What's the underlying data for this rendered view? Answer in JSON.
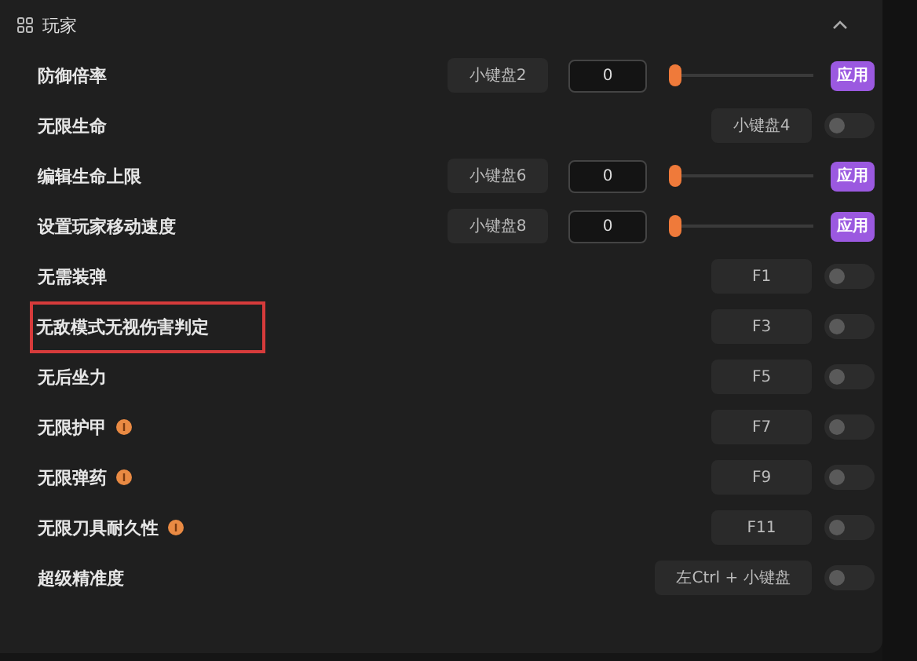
{
  "section": {
    "title": "玩家",
    "expanded": true
  },
  "rows": [
    {
      "kind": "slider",
      "label": "防御倍率",
      "hotkey": "小键盘2",
      "value": "0",
      "level": 0,
      "button": "应用",
      "info": false,
      "highlighted": false
    },
    {
      "kind": "toggle",
      "label": "无限生命",
      "hotkey": "小键盘4",
      "on": false,
      "info": false,
      "highlighted": false
    },
    {
      "kind": "slider",
      "label": "编辑生命上限",
      "hotkey": "小键盘6",
      "value": "0",
      "level": 0,
      "button": "应用",
      "info": false,
      "highlighted": false
    },
    {
      "kind": "slider",
      "label": "设置玩家移动速度",
      "hotkey": "小键盘8",
      "value": "0",
      "level": 0,
      "button": "应用",
      "info": false,
      "highlighted": false
    },
    {
      "kind": "toggle",
      "label": "无需装弹",
      "hotkey": "F1",
      "on": false,
      "info": false,
      "highlighted": false
    },
    {
      "kind": "toggle",
      "label": "无敌模式无视伤害判定",
      "hotkey": "F3",
      "on": false,
      "info": false,
      "highlighted": true
    },
    {
      "kind": "toggle",
      "label": "无后坐力",
      "hotkey": "F5",
      "on": false,
      "info": false,
      "highlighted": false
    },
    {
      "kind": "toggle",
      "label": "无限护甲",
      "hotkey": "F7",
      "on": false,
      "info": true,
      "highlighted": false
    },
    {
      "kind": "toggle",
      "label": "无限弹药",
      "hotkey": "F9",
      "on": false,
      "info": true,
      "highlighted": false
    },
    {
      "kind": "toggle",
      "label": "无限刀具耐久性",
      "hotkey": "F11",
      "on": false,
      "info": true,
      "highlighted": false
    },
    {
      "kind": "toggle",
      "label": "超级精准度",
      "hotkey": "左Ctrl + 小键盘",
      "on": false,
      "info": false,
      "highlighted": false
    }
  ]
}
